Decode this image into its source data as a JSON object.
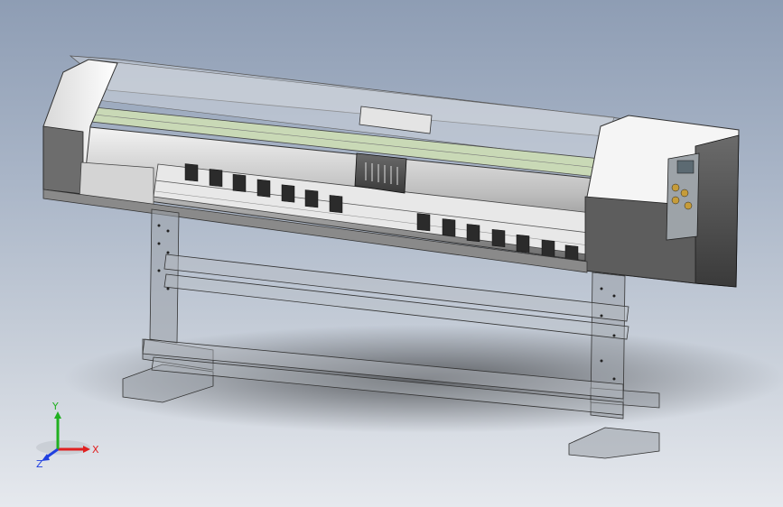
{
  "viewport": {
    "background_top": "#8e9db4",
    "background_bottom": "#e6e9ee"
  },
  "model": {
    "subject": "wide-format-printer-assembly",
    "render_mode": "shaded-with-edges-transparent"
  },
  "triad": {
    "x_label": "X",
    "y_label": "Y",
    "z_label": "Z",
    "x_color": "#e02020",
    "y_color": "#20b020",
    "z_color": "#2040e0"
  }
}
